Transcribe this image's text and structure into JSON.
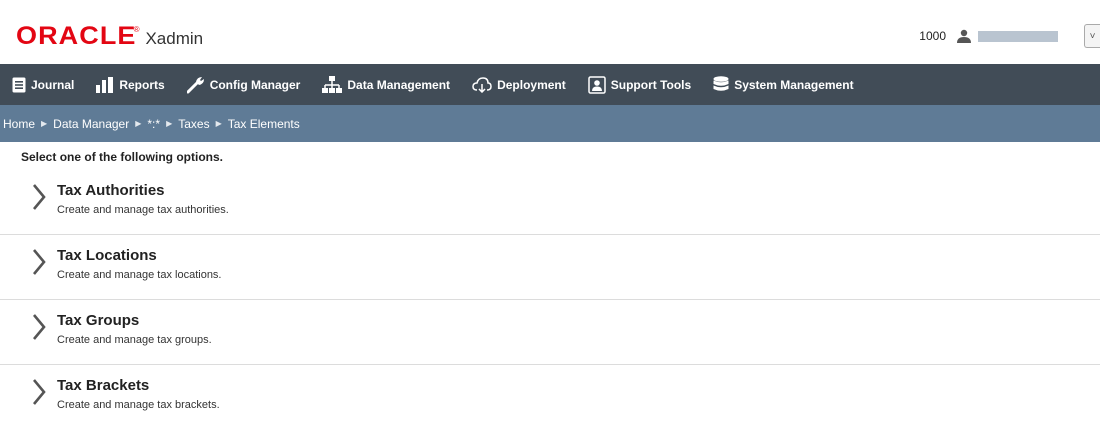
{
  "header": {
    "brand": "ORACLE",
    "app_name": "Xadmin",
    "store_number": "1000",
    "user_icon": "person-icon",
    "dropdown_icon": "chevron-down-icon",
    "dropdown_glyph": "˅"
  },
  "nav": {
    "items": [
      {
        "label": "Journal",
        "icon": "journal-icon"
      },
      {
        "label": "Reports",
        "icon": "bar-chart-icon"
      },
      {
        "label": "Config Manager",
        "icon": "wrench-icon"
      },
      {
        "label": "Data Management",
        "icon": "org-chart-icon"
      },
      {
        "label": "Deployment",
        "icon": "cloud-download-icon"
      },
      {
        "label": "Support Tools",
        "icon": "support-person-icon"
      },
      {
        "label": "System Management",
        "icon": "database-icon"
      }
    ]
  },
  "breadcrumb": {
    "items": [
      "Home",
      "Data Manager",
      "*:*",
      "Taxes",
      "Tax Elements"
    ],
    "separator": "▶"
  },
  "main": {
    "instructions": "Select one of the following options.",
    "options": [
      {
        "title": "Tax Authorities",
        "description": "Create and manage tax authorities."
      },
      {
        "title": "Tax Locations",
        "description": "Create and manage tax locations."
      },
      {
        "title": "Tax Groups",
        "description": "Create and manage tax groups."
      },
      {
        "title": "Tax Brackets",
        "description": "Create and manage tax brackets."
      }
    ]
  },
  "colors": {
    "brand_red": "#e30613",
    "nav_bg": "#414c57",
    "breadcrumb_bg": "#5f7b96"
  }
}
